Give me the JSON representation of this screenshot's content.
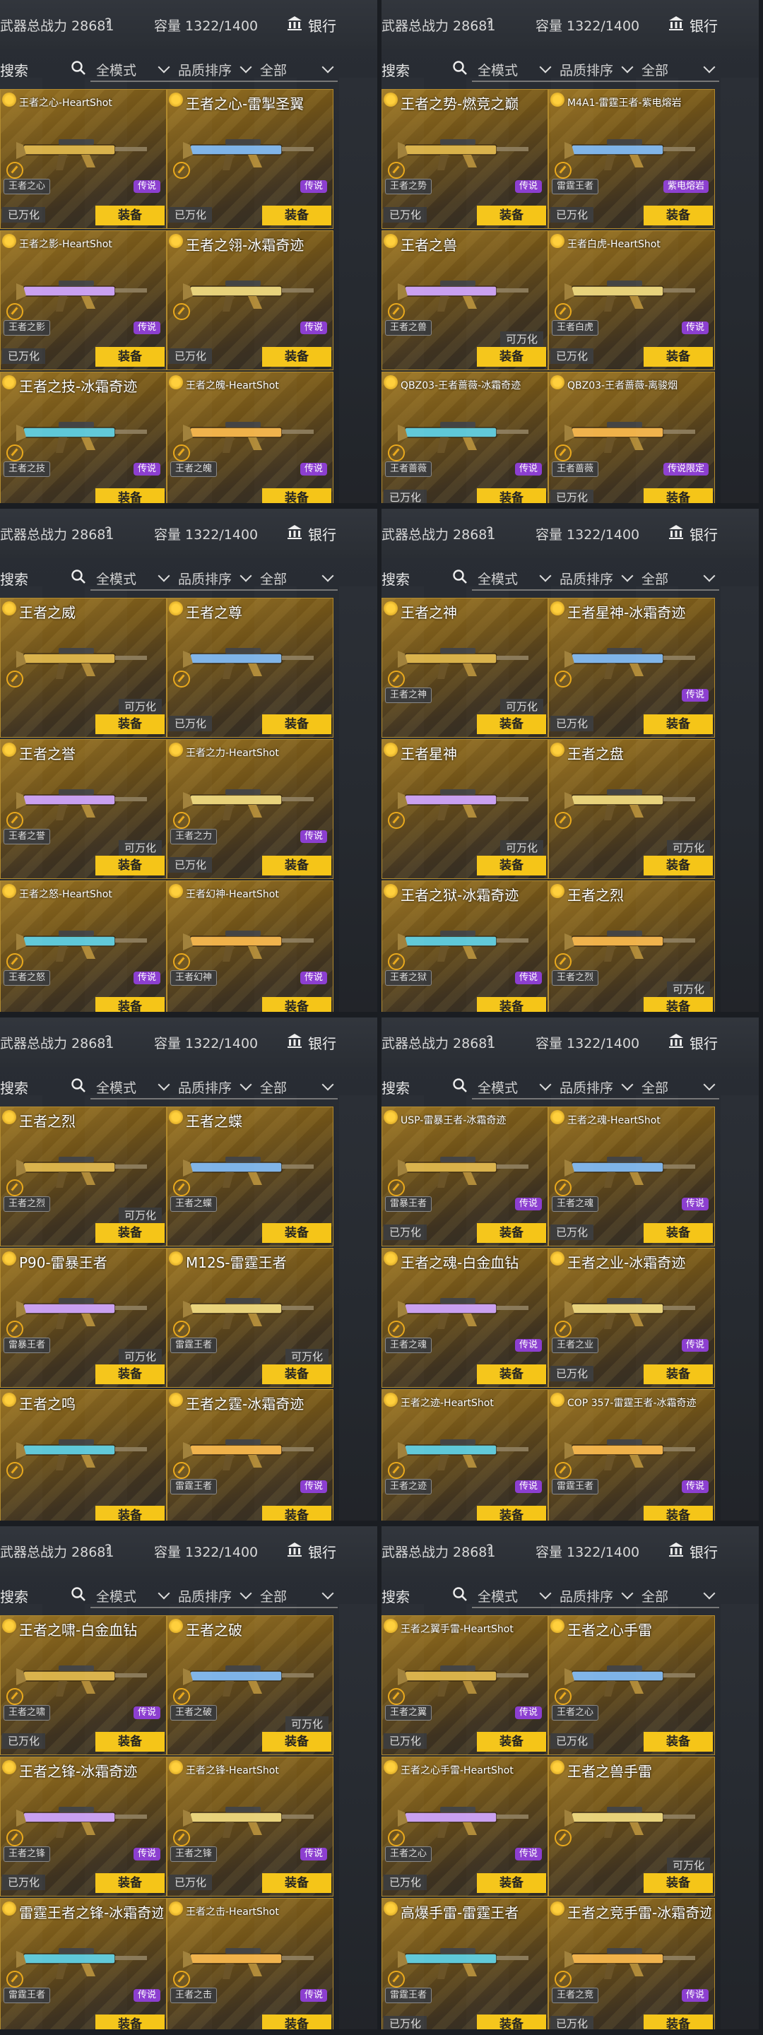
{
  "header": {
    "power_label": "武器总战力 28681",
    "help": "?",
    "capacity_label": "容量 1322/1400",
    "bank_label": "银行"
  },
  "filters": {
    "search_label": "搜索",
    "mode": "全模式",
    "sort": "品质排序",
    "category": "全部"
  },
  "buttons": {
    "equip": "装备"
  },
  "colors": {
    "equip_button": "#f5c518",
    "legend_badge": "#8c3fd0",
    "card_gold": "#9a7423"
  },
  "panels": [
    {
      "items": [
        {
          "name": "王者之心-HeartShot",
          "tag": "王者之心",
          "legend": "传说",
          "status": "已万化"
        },
        {
          "name": "王者之心-雷掣圣翼",
          "tag": "",
          "legend": "传说",
          "status": "已万化"
        },
        {
          "name": "王者之影-HeartShot",
          "tag": "王者之影",
          "legend": "传说",
          "status": "已万化"
        },
        {
          "name": "王者之翎-冰霜奇迹",
          "tag": "",
          "legend": "传说",
          "status": "已万化"
        },
        {
          "name": "王者之技-冰霜奇迹",
          "tag": "王者之技",
          "legend": "传说",
          "status": ""
        },
        {
          "name": "王者之魄-HeartShot",
          "tag": "王者之魄",
          "legend": "传说",
          "status": ""
        }
      ]
    },
    {
      "items": [
        {
          "name": "王者之势-燃竞之巅",
          "tag": "王者之势",
          "legend": "传说",
          "status": "已万化"
        },
        {
          "name": "M4A1-雷霆王者-紫电熔岩",
          "tag": "雷霆王者",
          "legend": "紫电熔岩",
          "status": "已万化"
        },
        {
          "name": "王者之兽",
          "tag": "王者之兽",
          "legend": "",
          "status": "可万化"
        },
        {
          "name": "王者白虎-HeartShot",
          "tag": "王者白虎",
          "legend": "传说",
          "status": "已万化"
        },
        {
          "name": "QBZ03-王者蔷薇-冰霜奇迹",
          "tag": "王者蔷薇",
          "legend": "传说",
          "status": "已万化"
        },
        {
          "name": "QBZ03-王者蔷薇-离骏烟",
          "tag": "王者蔷薇",
          "legend": "传说限定",
          "status": "已万化"
        }
      ]
    },
    {
      "items": [
        {
          "name": "王者之威",
          "tag": "",
          "legend": "",
          "status": "可万化"
        },
        {
          "name": "王者之尊",
          "tag": "",
          "legend": "",
          "status": "已万化"
        },
        {
          "name": "王者之誉",
          "tag": "王者之誉",
          "legend": "",
          "status": "可万化"
        },
        {
          "name": "王者之力-HeartShot",
          "tag": "王者之力",
          "legend": "传说",
          "status": "已万化"
        },
        {
          "name": "王者之怒-HeartShot",
          "tag": "王者之怒",
          "legend": "传说",
          "status": ""
        },
        {
          "name": "王者幻神-HeartShot",
          "tag": "王者幻神",
          "legend": "传说",
          "status": ""
        }
      ]
    },
    {
      "items": [
        {
          "name": "王者之神",
          "tag": "王者之神",
          "legend": "",
          "status": "可万化"
        },
        {
          "name": "王者星神-冰霜奇迹",
          "tag": "",
          "legend": "传说",
          "status": "已万化"
        },
        {
          "name": "王者星神",
          "tag": "",
          "legend": "",
          "status": "可万化"
        },
        {
          "name": "王者之盘",
          "tag": "",
          "legend": "",
          "status": "可万化"
        },
        {
          "name": "王者之狱-冰霜奇迹",
          "tag": "王者之狱",
          "legend": "传说",
          "status": ""
        },
        {
          "name": "王者之烈",
          "tag": "王者之烈",
          "legend": "",
          "status": "可万化"
        }
      ]
    },
    {
      "items": [
        {
          "name": "王者之烈",
          "tag": "王者之烈",
          "legend": "",
          "status": "可万化"
        },
        {
          "name": "王者之蝶",
          "tag": "王者之蝶",
          "legend": "",
          "status": ""
        },
        {
          "name": "P90-雷暴王者",
          "tag": "雷暴王者",
          "legend": "",
          "status": "可万化"
        },
        {
          "name": "M12S-雷霆王者",
          "tag": "雷霆王者",
          "legend": "",
          "status": "可万化"
        },
        {
          "name": "王者之鸣",
          "tag": "",
          "legend": "",
          "status": ""
        },
        {
          "name": "王者之霆-冰霜奇迹",
          "tag": "雷霆王者",
          "legend": "传说",
          "status": ""
        }
      ]
    },
    {
      "items": [
        {
          "name": "USP-雷暴王者-冰霜奇迹",
          "tag": "雷暴王者",
          "legend": "传说",
          "status": "已万化"
        },
        {
          "name": "王者之魂-HeartShot",
          "tag": "王者之魂",
          "legend": "传说",
          "status": "已万化"
        },
        {
          "name": "王者之魂-白金血钻",
          "tag": "王者之魂",
          "legend": "传说",
          "status": ""
        },
        {
          "name": "王者之业-冰霜奇迹",
          "tag": "王者之业",
          "legend": "传说",
          "status": "已万化"
        },
        {
          "name": "王者之迹-HeartShot",
          "tag": "王者之迹",
          "legend": "传说",
          "status": ""
        },
        {
          "name": "COP 357-雷霆王者-冰霜奇迹",
          "tag": "雷霆王者",
          "legend": "传说",
          "status": ""
        }
      ]
    },
    {
      "items": [
        {
          "name": "王者之啸-白金血钻",
          "tag": "王者之啸",
          "legend": "传说",
          "status": "已万化"
        },
        {
          "name": "王者之破",
          "tag": "王者之破",
          "legend": "",
          "status": "可万化"
        },
        {
          "name": "王者之锋-冰霜奇迹",
          "tag": "王者之锋",
          "legend": "传说",
          "status": "已万化"
        },
        {
          "name": "王者之锋-HeartShot",
          "tag": "王者之锋",
          "legend": "传说",
          "status": "已万化"
        },
        {
          "name": "雷霆王者之锋-冰霜奇迹",
          "tag": "雷霆王者",
          "legend": "传说",
          "status": ""
        },
        {
          "name": "王者之击-HeartShot",
          "tag": "王者之击",
          "legend": "传说",
          "status": ""
        }
      ]
    },
    {
      "items": [
        {
          "name": "王者之翼手雷-HeartShot",
          "tag": "王者之翼",
          "legend": "传说",
          "status": "已万化"
        },
        {
          "name": "王者之心手雷",
          "tag": "王者之心",
          "legend": "",
          "status": "已万化"
        },
        {
          "name": "王者之心手雷-HeartShot",
          "tag": "王者之心",
          "legend": "传说",
          "status": "已万化"
        },
        {
          "name": "王者之兽手雷",
          "tag": "",
          "legend": "",
          "status": "可万化"
        },
        {
          "name": "高爆手雷-雷霆王者",
          "tag": "雷霆王者",
          "legend": "",
          "status": "已万化"
        },
        {
          "name": "王者之竞手雷-冰霜奇迹",
          "tag": "王者之竞",
          "legend": "传说",
          "status": "已万化"
        }
      ]
    }
  ]
}
